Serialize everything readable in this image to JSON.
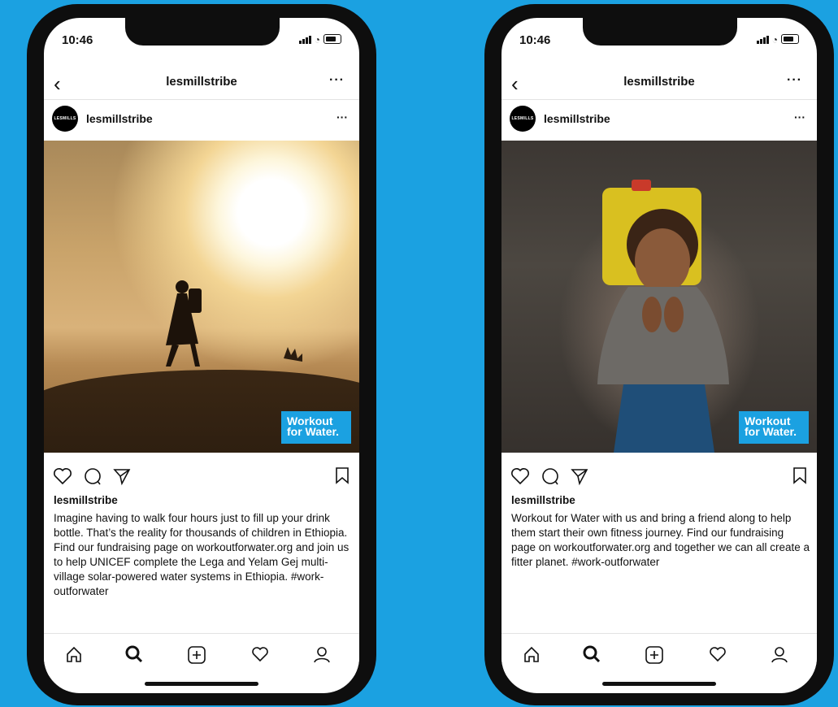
{
  "colors": {
    "background": "#1ba1e1",
    "badge": "#1ba1e1"
  },
  "phones": [
    {
      "status_time": "10:46",
      "nav_title": "lesmillstribe",
      "nav_more": "···",
      "avatar_text": "LESMILLS",
      "post_user": "lesmillstribe",
      "post_more": "···",
      "badge_line1": "Workout",
      "badge_line2": "for Water.",
      "caption_user": "lesmillstribe",
      "caption": "Imagine having to walk four hours just to fill up your drink bottle. That’s the reality for thousands of children in Ethiopia. Find our fundraising page on workoutforwater.org and join us to help UNICEF complete the Lega and Yelam Gej multi-village solar-powered water systems in Ethiopia. #work-outforwater"
    },
    {
      "status_time": "10:46",
      "nav_title": "lesmillstribe",
      "nav_more": "···",
      "avatar_text": "LESMILLS",
      "post_user": "lesmillstribe",
      "post_more": "···",
      "badge_line1": "Workout",
      "badge_line2": "for Water.",
      "caption_user": "lesmillstribe",
      "caption": "Workout for Water with us and bring a friend along to help them start their own fitness journey. Find our fundraising page on workoutforwater.org and together we can all create a fitter planet. #work-outforwater"
    }
  ],
  "icons": {
    "back": "chevron-left-icon",
    "like": "heart-icon",
    "comment": "comment-icon",
    "share": "send-icon",
    "save": "bookmark-icon",
    "home": "home-icon",
    "search": "search-icon",
    "add": "add-post-icon",
    "activity": "heart-icon",
    "profile": "profile-icon"
  }
}
